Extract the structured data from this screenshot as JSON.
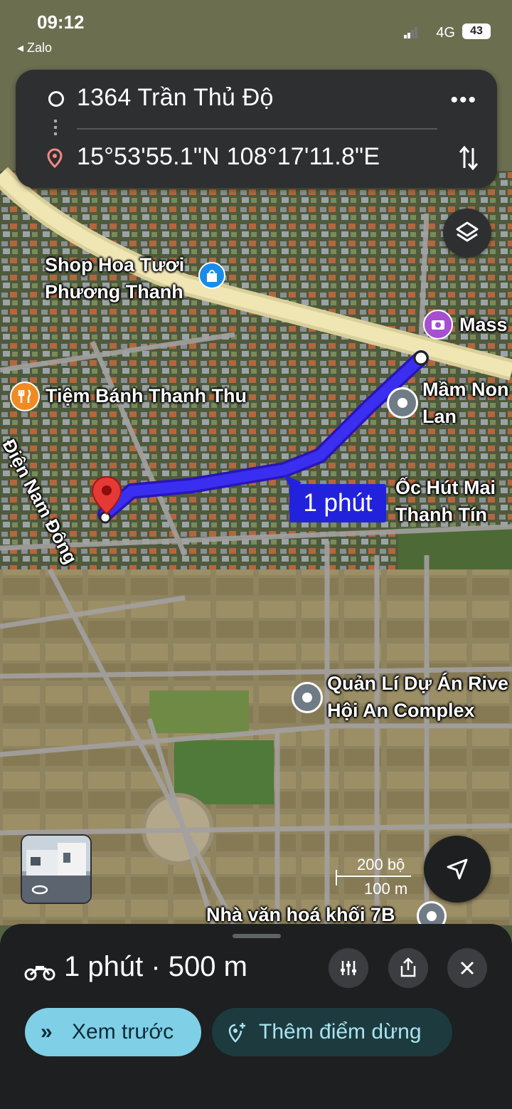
{
  "status_bar": {
    "time": "09:12",
    "back_app": "◂ Zalo",
    "network": "4G",
    "battery": "43"
  },
  "directions": {
    "origin": "1364 Trần Thủ Độ",
    "destination": "15°53'55.1\"N 108°17'11.8\"E",
    "more_icon": "more-horizontal-icon",
    "swap_icon": "swap-vertical-icon"
  },
  "map": {
    "route_duration_label": "1 phút",
    "places": [
      {
        "name": "Shop Hoa Tươi\nPhương Thanh",
        "icon": "shopping-bag-icon"
      },
      {
        "name": "Mass",
        "icon": "camera-icon"
      },
      {
        "name": "Tiệm Bánh Thanh Thu",
        "icon": "restaurant-icon"
      },
      {
        "name": "Mầm Non\nLan",
        "icon": "place-icon"
      },
      {
        "name": "Ốc Hút Mai\nThanh Tín",
        "icon": "none"
      },
      {
        "name": "Quản Lí Dự Án Rive\nHội An Complex",
        "icon": "place-icon"
      },
      {
        "name": "Nhà văn hoá khối 7B",
        "icon": "place-icon"
      }
    ],
    "streets": [
      {
        "name": "Điện Nam Đông"
      }
    ],
    "scale": {
      "feet": "200 bộ",
      "meters": "100 m"
    },
    "colors": {
      "route": "#3a1fd8",
      "pin": "#e53935"
    }
  },
  "route_summary": {
    "mode_icon": "motorcycle-icon",
    "text": "1 phút · 500 m",
    "actions": [
      {
        "icon": "route-options-icon"
      },
      {
        "icon": "share-icon"
      },
      {
        "icon": "close-icon"
      }
    ],
    "preview_button": "Xem trước",
    "add_stop_button": "Thêm điểm dừng"
  }
}
